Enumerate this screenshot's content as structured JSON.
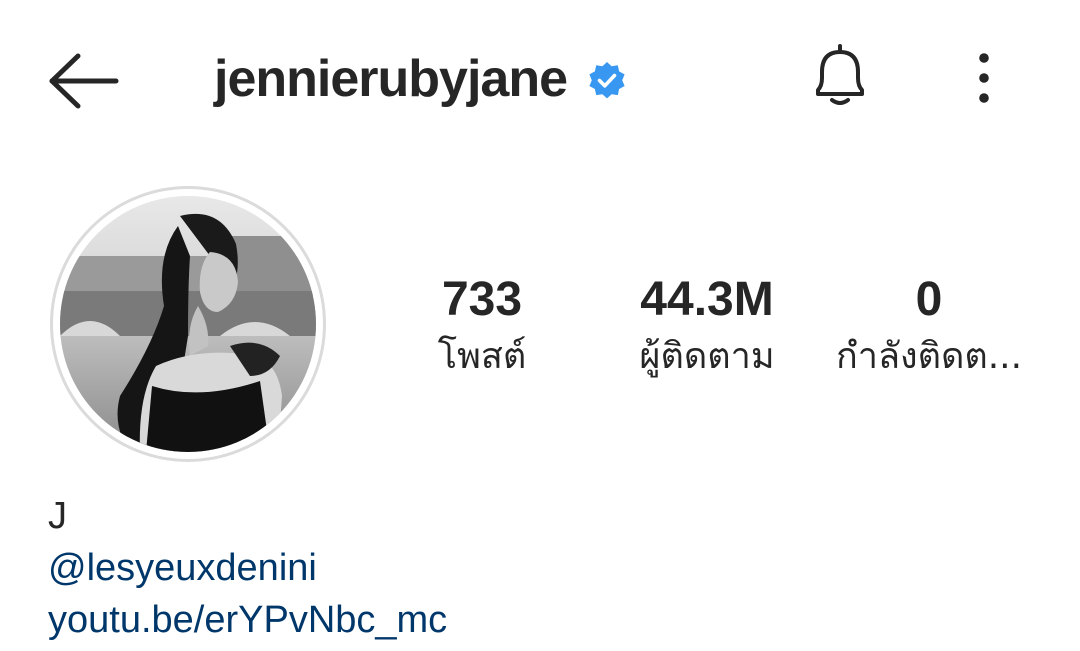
{
  "header": {
    "username": "jennierubyjane",
    "back_icon": "arrow-left-icon",
    "verified_icon": "verified-badge-icon",
    "bell_icon": "bell-icon",
    "more_icon": "more-vertical-icon"
  },
  "profile": {
    "avatar_icon": "profile-photo",
    "stats": [
      {
        "count": "733",
        "label": "โพสต์"
      },
      {
        "count": "44.3M",
        "label": "ผู้ติดตาม"
      },
      {
        "count": "0",
        "label": "กำลังติดต..."
      }
    ]
  },
  "bio": {
    "name": "J",
    "mention": "@lesyeuxdenini",
    "link": "youtu.be/erYPvNbc_mc"
  },
  "colors": {
    "text": "#262626",
    "verified": "#3897f0",
    "link": "#00376b",
    "ring": "#dbdbdb"
  }
}
